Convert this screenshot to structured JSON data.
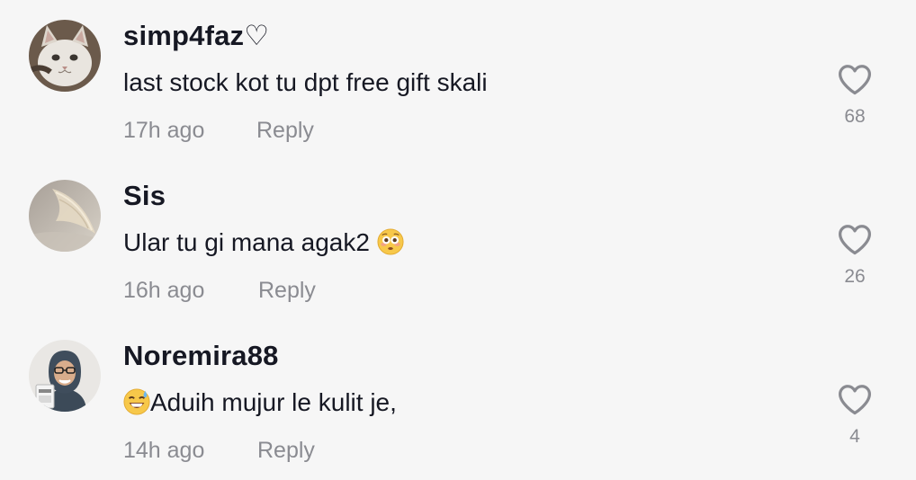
{
  "comments": [
    {
      "username": "simp4faz♡",
      "text": "last stock kot tu dpt free gift skali",
      "time": "17h ago",
      "reply": "Reply",
      "likes": "68"
    },
    {
      "username": "Sis",
      "text": "Ular tu gi mana agak2",
      "emoji_after": "flushed-face-emoji",
      "time": "16h ago",
      "reply": "Reply",
      "likes": "26"
    },
    {
      "username": "Noremira88",
      "emoji_before": "sweat-smile-emoji",
      "text": "Aduih mujur le kulit je,",
      "time": "14h ago",
      "reply": "Reply",
      "likes": "4"
    }
  ],
  "colors": {
    "background": "#f6f6f6",
    "primary_text": "#161823",
    "secondary_text": "#8a8b91",
    "icon": "#8a8b91"
  }
}
